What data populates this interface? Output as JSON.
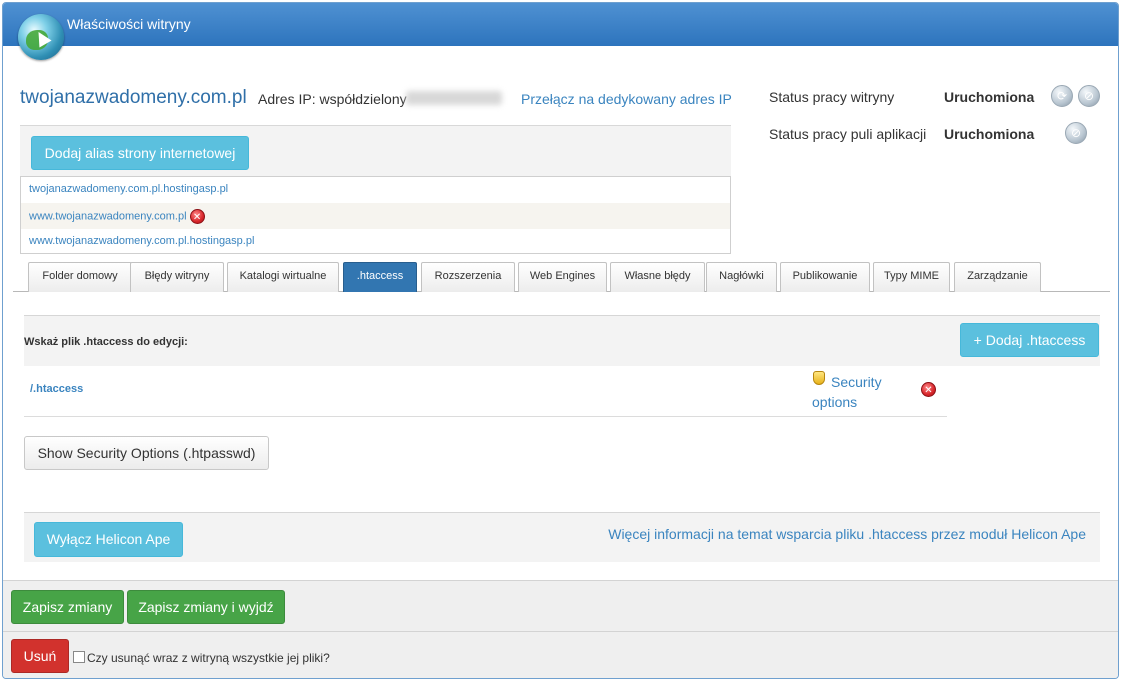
{
  "window": {
    "title": "Właściwości witryny"
  },
  "site": {
    "domain": "twojanazwadomeny.com.pl",
    "ip_label": "Adres IP: współdzielony",
    "switch_ip_link": "Przełącz na dedykowany adres IP"
  },
  "status": {
    "site_label": "Status pracy witryny",
    "site_value": "Uruchomiona",
    "pool_label": "Status pracy puli aplikacji",
    "pool_value": "Uruchomiona"
  },
  "aliases": {
    "add_button": "Dodaj alias strony internetowej",
    "items": [
      {
        "url": "twojanazwadomeny.com.pl.hostingasp.pl",
        "deletable": false
      },
      {
        "url": "www.twojanazwadomeny.com.pl",
        "deletable": true
      },
      {
        "url": "www.twojanazwadomeny.com.pl.hostingasp.pl",
        "deletable": false
      }
    ]
  },
  "tabs": [
    {
      "label": "Folder domowy",
      "active": false
    },
    {
      "label": "Błędy witryny",
      "active": false
    },
    {
      "label": "Katalogi wirtualne",
      "active": false
    },
    {
      "label": ".htaccess",
      "active": true
    },
    {
      "label": "Rozszerzenia",
      "active": false
    },
    {
      "label": "Web Engines",
      "active": false
    },
    {
      "label": "Własne błędy",
      "active": false
    },
    {
      "label": "Nagłówki",
      "active": false
    },
    {
      "label": "Publikowanie",
      "active": false
    },
    {
      "label": "Typy MIME",
      "active": false
    },
    {
      "label": "Zarządzanie",
      "active": false
    }
  ],
  "htaccess": {
    "select_label": "Wskaż plik .htaccess do edycji:",
    "add_button": "+ Dodaj .htaccess",
    "file": "/.htaccess",
    "security_options_link": "Security options",
    "show_security_button": "Show Security Options (.htpasswd)",
    "disable_helicon_button": "Wyłącz Helicon Ape",
    "helicon_info_link": "Więcej informacji na temat wsparcia pliku .htaccess przez moduł Helicon Ape"
  },
  "footer": {
    "save_button": "Zapisz zmiany",
    "save_exit_button": "Zapisz zmiany i wyjdź",
    "delete_button": "Usuń",
    "delete_files_checkbox": "Czy usunąć wraz z witryną wszystkie jej pliki?"
  },
  "icons": {
    "logo": "globe-icon",
    "restart": "refresh-icon",
    "stop": "stop-icon",
    "delete": "delete-icon",
    "security": "shield-icon"
  },
  "colors": {
    "header": "#3a80c6",
    "link": "#3a84bf",
    "info_button": "#5bc0de",
    "success_button": "#47a447",
    "danger_button": "#d2322d",
    "active_tab": "#3276b1"
  }
}
